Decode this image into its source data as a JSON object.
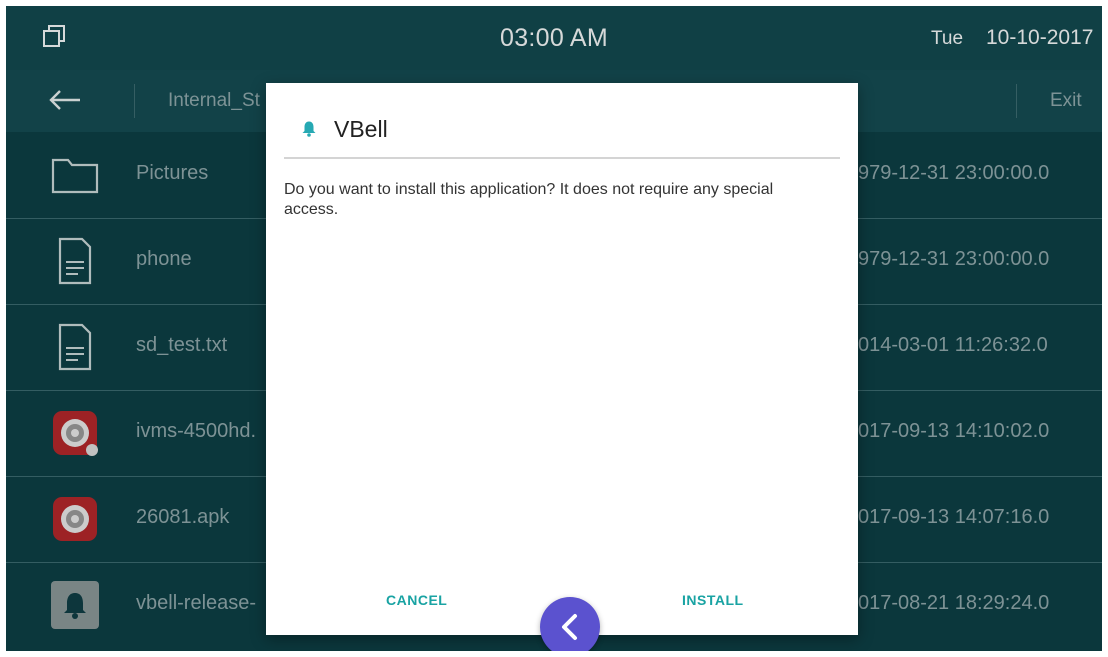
{
  "statusbar": {
    "time": "03:00 AM",
    "day": "Tue",
    "date": "10-10-2017",
    "window_icon": "window-restore-icon"
  },
  "toolbar": {
    "back_icon": "arrow-left-icon",
    "path": "Internal_St",
    "exit_label": "Exit"
  },
  "files": [
    {
      "icon": "folder-icon",
      "name": "Pictures",
      "date": "979-12-31 23:00:00.0"
    },
    {
      "icon": "document-icon",
      "name": "phone",
      "date": "979-12-31 23:00:00.0"
    },
    {
      "icon": "document-icon",
      "name": "sd_test.txt",
      "date": "014-03-01 11:26:32.0"
    },
    {
      "icon": "ivms-app-icon",
      "name": "ivms-4500hd.",
      "date": "017-09-13 14:10:02.0"
    },
    {
      "icon": "ivms-app-icon",
      "name": "26081.apk",
      "date": "017-09-13 14:07:16.0"
    },
    {
      "icon": "bell-app-icon",
      "name": "vbell-release-",
      "date": "017-08-21 18:29:24.0"
    }
  ],
  "dialog": {
    "app_icon": "bell-icon",
    "title": "VBell",
    "message": "Do you want to install this application? It does not require any special access.",
    "cancel_label": "CANCEL",
    "install_label": "INSTALL"
  },
  "fab": {
    "icon": "chevron-left-icon"
  },
  "colors": {
    "background": "#0d3f45",
    "statusbar": "#13494f",
    "accent": "#19a3a3",
    "fab": "#5b52cf"
  }
}
